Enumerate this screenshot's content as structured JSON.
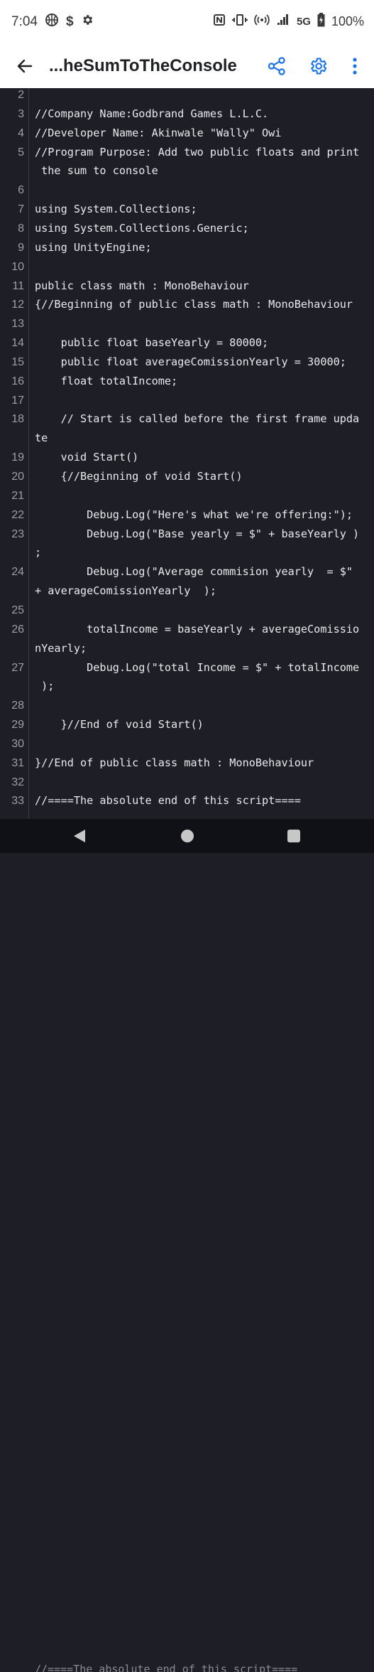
{
  "status": {
    "time": "7:04",
    "dollar": "$",
    "network": "5G",
    "battery": "100%"
  },
  "toolbar": {
    "title": "...heSumToTheConsole"
  },
  "colors": {
    "accent": "#1a73e8",
    "editor_bg": "#1e1f26",
    "code_text": "#e8eaed",
    "line_number": "#9aa0a6"
  },
  "icons": [
    "basketball-icon",
    "dollar-icon",
    "gear-icon",
    "nfc-icon",
    "vibrate-icon",
    "hotspot-icon",
    "signal-icon",
    "battery-icon",
    "back-arrow-icon",
    "share-icon",
    "settings-icon",
    "more-vert-icon",
    "nav-back-icon",
    "nav-home-icon",
    "nav-recents-icon"
  ],
  "code_rows": [
    {
      "n": "2",
      "text": ""
    },
    {
      "n": "3",
      "text": "//Company Name:Godbrand Games L.L.C."
    },
    {
      "n": "4",
      "text": "//Developer Name: Akinwale \"Wally\" Owi"
    },
    {
      "n": "5",
      "text": "//Program Purpose: Add two public floats and print"
    },
    {
      "n": "",
      "text": " the sum to console"
    },
    {
      "n": "6",
      "text": ""
    },
    {
      "n": "7",
      "text": "using System.Collections;"
    },
    {
      "n": "8",
      "text": "using System.Collections.Generic;"
    },
    {
      "n": "9",
      "text": "using UnityEngine;"
    },
    {
      "n": "10",
      "text": ""
    },
    {
      "n": "11",
      "text": "public class math : MonoBehaviour"
    },
    {
      "n": "12",
      "text": "{//Beginning of public class math : MonoBehaviour"
    },
    {
      "n": "13",
      "text": ""
    },
    {
      "n": "14",
      "text": "    public float baseYearly = 80000;"
    },
    {
      "n": "15",
      "text": "    public float averageComissionYearly = 30000;"
    },
    {
      "n": "16",
      "text": "    float totalIncome;"
    },
    {
      "n": "17",
      "text": ""
    },
    {
      "n": "18",
      "text": "    // Start is called before the first frame upda"
    },
    {
      "n": "",
      "text": "te"
    },
    {
      "n": "19",
      "text": "    void Start()"
    },
    {
      "n": "20",
      "text": "    {//Beginning of void Start()"
    },
    {
      "n": "21",
      "text": ""
    },
    {
      "n": "22",
      "text": "        Debug.Log(\"Here's what we're offering:\");"
    },
    {
      "n": "23",
      "text": "        Debug.Log(\"Base yearly = $\" + baseYearly )"
    },
    {
      "n": "",
      "text": ";"
    },
    {
      "n": "24",
      "text": "        Debug.Log(\"Average commision yearly  = $\""
    },
    {
      "n": "",
      "text": "+ averageComissionYearly  );"
    },
    {
      "n": "25",
      "text": ""
    },
    {
      "n": "26",
      "text": "        totalIncome = baseYearly + averageComissio"
    },
    {
      "n": "",
      "text": "nYearly;"
    },
    {
      "n": "27",
      "text": "        Debug.Log(\"total Income = $\" + totalIncome"
    },
    {
      "n": "",
      "text": " );"
    },
    {
      "n": "28",
      "text": ""
    },
    {
      "n": "29",
      "text": "    }//End of void Start()"
    },
    {
      "n": "30",
      "text": ""
    },
    {
      "n": "31",
      "text": "}//End of public class math : MonoBehaviour"
    },
    {
      "n": "32",
      "text": ""
    },
    {
      "n": "33",
      "text": "//====The absolute end of this script===="
    }
  ],
  "peek_text": "//====The absolute end of this script===="
}
